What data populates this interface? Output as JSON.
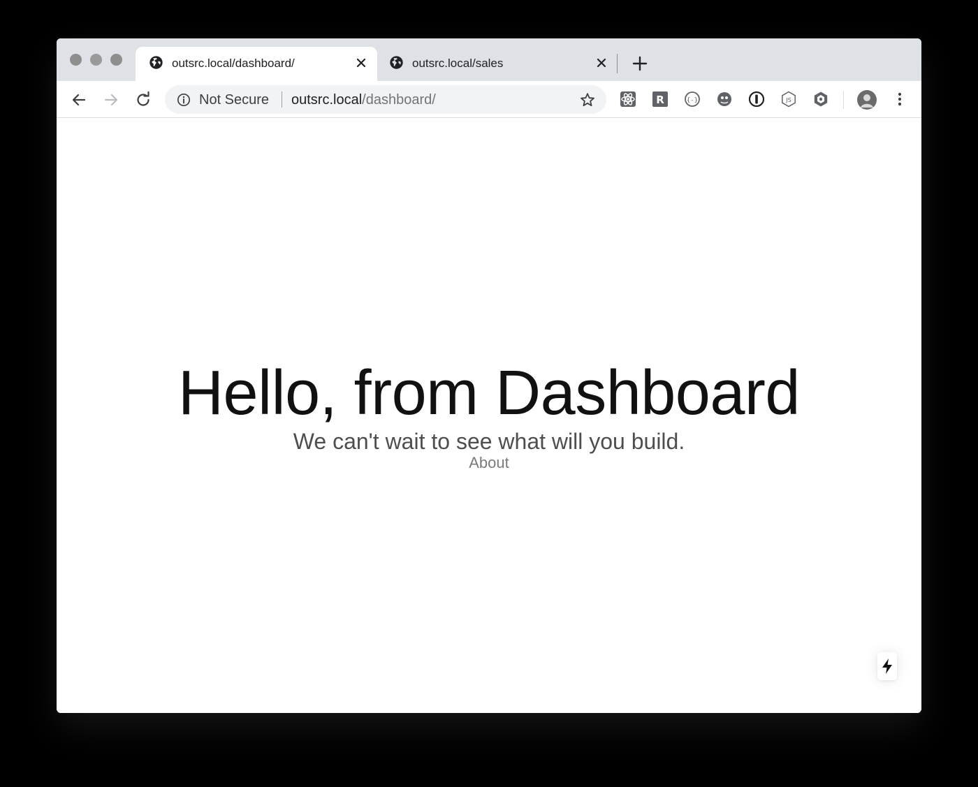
{
  "tabs": [
    {
      "title": "outsrc.local/dashboard/",
      "active": true
    },
    {
      "title": "outsrc.local/sales",
      "active": false
    }
  ],
  "address_bar": {
    "security_label": "Not Secure",
    "url_host": "outsrc.local",
    "url_path": "/dashboard/"
  },
  "extensions": [
    "react-devtools-icon",
    "r-extension-icon",
    "json-formatter-icon",
    "ghost-extension-icon",
    "1password-icon",
    "nodejs-icon",
    "codesandbox-icon"
  ],
  "page": {
    "heading": "Hello, from Dashboard",
    "subheading": "We can't wait to see what will you build.",
    "link_about": "About"
  },
  "colors": {
    "tabstrip_bg": "#dee1e6",
    "omnibox_bg": "#f1f3f4",
    "heading_color": "#111111",
    "subheading_color": "#4e4e4e",
    "link_color": "#7a7a7a"
  }
}
